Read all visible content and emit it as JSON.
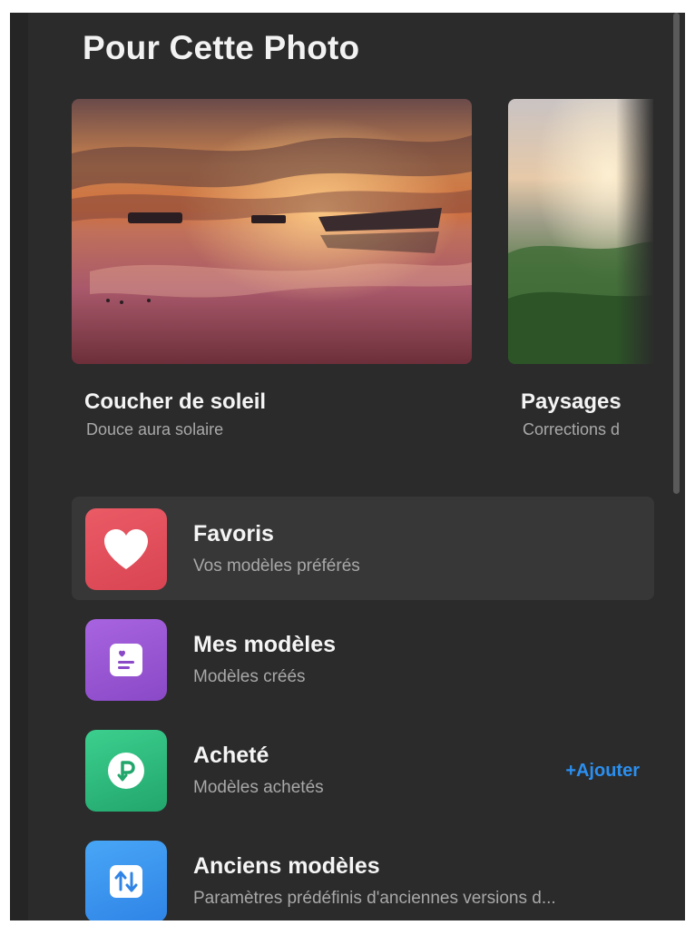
{
  "section": {
    "title": "Pour Cette Photo"
  },
  "carousel": {
    "cards": [
      {
        "title": "Coucher de soleil",
        "subtitle": "Douce aura solaire",
        "image": "sunset-boats-image"
      },
      {
        "title": "Paysages",
        "subtitle": "Corrections d",
        "image": "misty-landscape-image"
      }
    ],
    "next_icon": "chevron-right-icon"
  },
  "list": {
    "items": [
      {
        "title": "Favoris",
        "subtitle": "Vos modèles préférés",
        "icon": "heart-icon",
        "color": "#e24f5c",
        "active": true
      },
      {
        "title": "Mes modèles",
        "subtitle": "Modèles créés",
        "icon": "template-card-icon",
        "color": "#9656d3"
      },
      {
        "title": "Acheté",
        "subtitle": "Modèles achetés",
        "icon": "purchase-icon",
        "color": "#2eb97c",
        "action": "+Ajouter"
      },
      {
        "title": "Anciens modèles",
        "subtitle": "Paramètres prédéfinis d'anciennes versions d...",
        "icon": "sort-arrows-icon",
        "color": "#3b95ee"
      }
    ]
  },
  "colors": {
    "background": "#2b2b2b",
    "accent": "#2b8ff0",
    "active_row": "#373737"
  }
}
